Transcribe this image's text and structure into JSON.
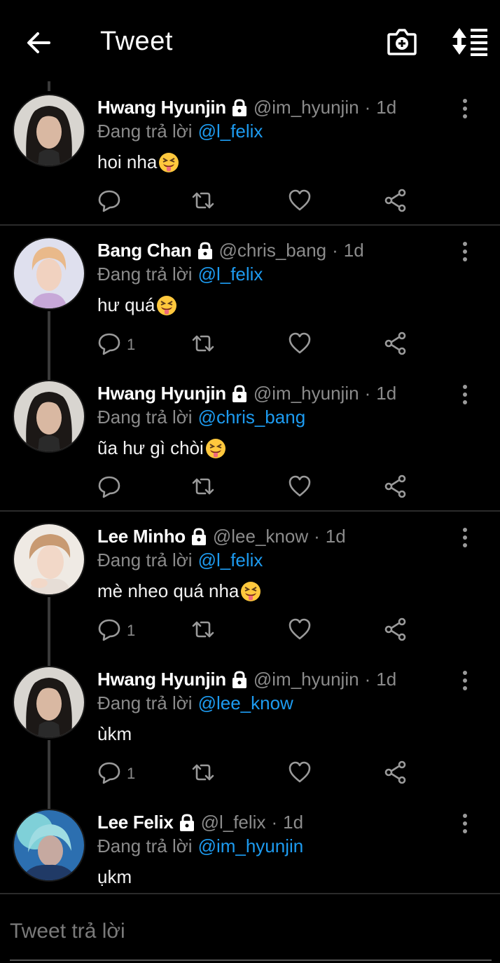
{
  "header": {
    "title": "Tweet"
  },
  "reply_prefix": "Đang trả lời",
  "tweets": [
    {
      "name": "Hwang Hyunjin",
      "handle": "@im_hyunjin",
      "time": "1d",
      "reply_to": "@l_felix",
      "text": "hoi nha",
      "emoji": "squinting-tongue-emoji",
      "reply_count": ""
    },
    {
      "name": "Bang Chan",
      "handle": "@chris_bang",
      "time": "1d",
      "reply_to": "@l_felix",
      "text": "hư quá",
      "emoji": "squinting-tongue-emoji",
      "reply_count": "1"
    },
    {
      "name": "Hwang Hyunjin",
      "handle": "@im_hyunjin",
      "time": "1d",
      "reply_to": "@chris_bang",
      "text": "ũa hư gì chòi",
      "emoji": "squinting-tongue-emoji",
      "reply_count": ""
    },
    {
      "name": "Lee Minho",
      "handle": "@lee_know",
      "time": "1d",
      "reply_to": "@l_felix",
      "text": "mè nheo quá nha",
      "emoji": "squinting-tongue-emoji",
      "reply_count": "1"
    },
    {
      "name": "Hwang Hyunjin",
      "handle": "@im_hyunjin",
      "time": "1d",
      "reply_to": "@lee_know",
      "text": "ùkm",
      "emoji": "",
      "reply_count": "1"
    },
    {
      "name": "Lee Felix",
      "handle": "@l_felix",
      "time": "1d",
      "reply_to": "@im_hyunjin",
      "text": "ụkm",
      "emoji": "",
      "reply_count": ""
    }
  ],
  "compose": {
    "placeholder": "Tweet trả lời"
  },
  "colors": {
    "background": "#000000",
    "mention": "#1d9bf0",
    "muted": "#8b8b8b"
  }
}
